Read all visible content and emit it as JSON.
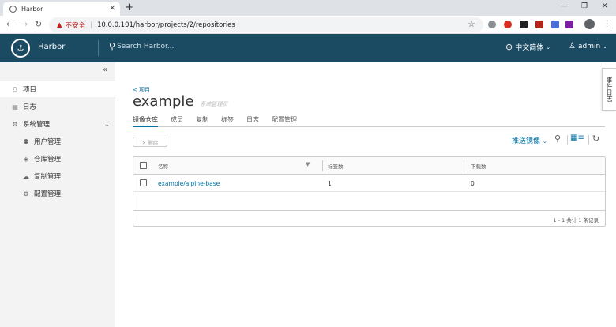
{
  "browser": {
    "tab_title": "Harbor",
    "tab_close": "✕",
    "new_tab": "+",
    "insecure_label": "不安全",
    "separator": "|",
    "url": "10.0.0.101/harbor/projects/2/repositories",
    "window_controls": [
      "—",
      "❐",
      "✕"
    ]
  },
  "header": {
    "brand": "Harbor",
    "search_placeholder": "Search Harbor...",
    "language": "中文简体",
    "user": "admin"
  },
  "sidebar": {
    "items": [
      {
        "label": "项目",
        "icon": "projects-icon"
      },
      {
        "label": "日志",
        "icon": "logs-icon"
      },
      {
        "label": "系统管理",
        "icon": "admin-icon"
      },
      {
        "label": "用户管理",
        "icon": "users-icon"
      },
      {
        "label": "仓库管理",
        "icon": "registry-icon"
      },
      {
        "label": "复制管理",
        "icon": "replication-icon"
      },
      {
        "label": "配置管理",
        "icon": "config-icon"
      }
    ]
  },
  "project": {
    "breadcrumb": "< 项目",
    "name": "example",
    "role": "系统管理员",
    "tabs": [
      "镜像仓库",
      "成员",
      "复制",
      "标签",
      "日志",
      "配置管理"
    ]
  },
  "toolbar": {
    "delete_label": "✕ 删除",
    "push_label": "推送镜像"
  },
  "grid": {
    "columns": [
      "名称",
      "标签数",
      "下载数"
    ],
    "rows": [
      {
        "name": "example/alpine-base",
        "tags": "1",
        "pulls": "0"
      }
    ],
    "footer": "1 - 1 共计 1 条记录"
  },
  "event_log": "事件日志",
  "colors": {
    "header": "#1b4a63",
    "link": "#0072a3"
  }
}
